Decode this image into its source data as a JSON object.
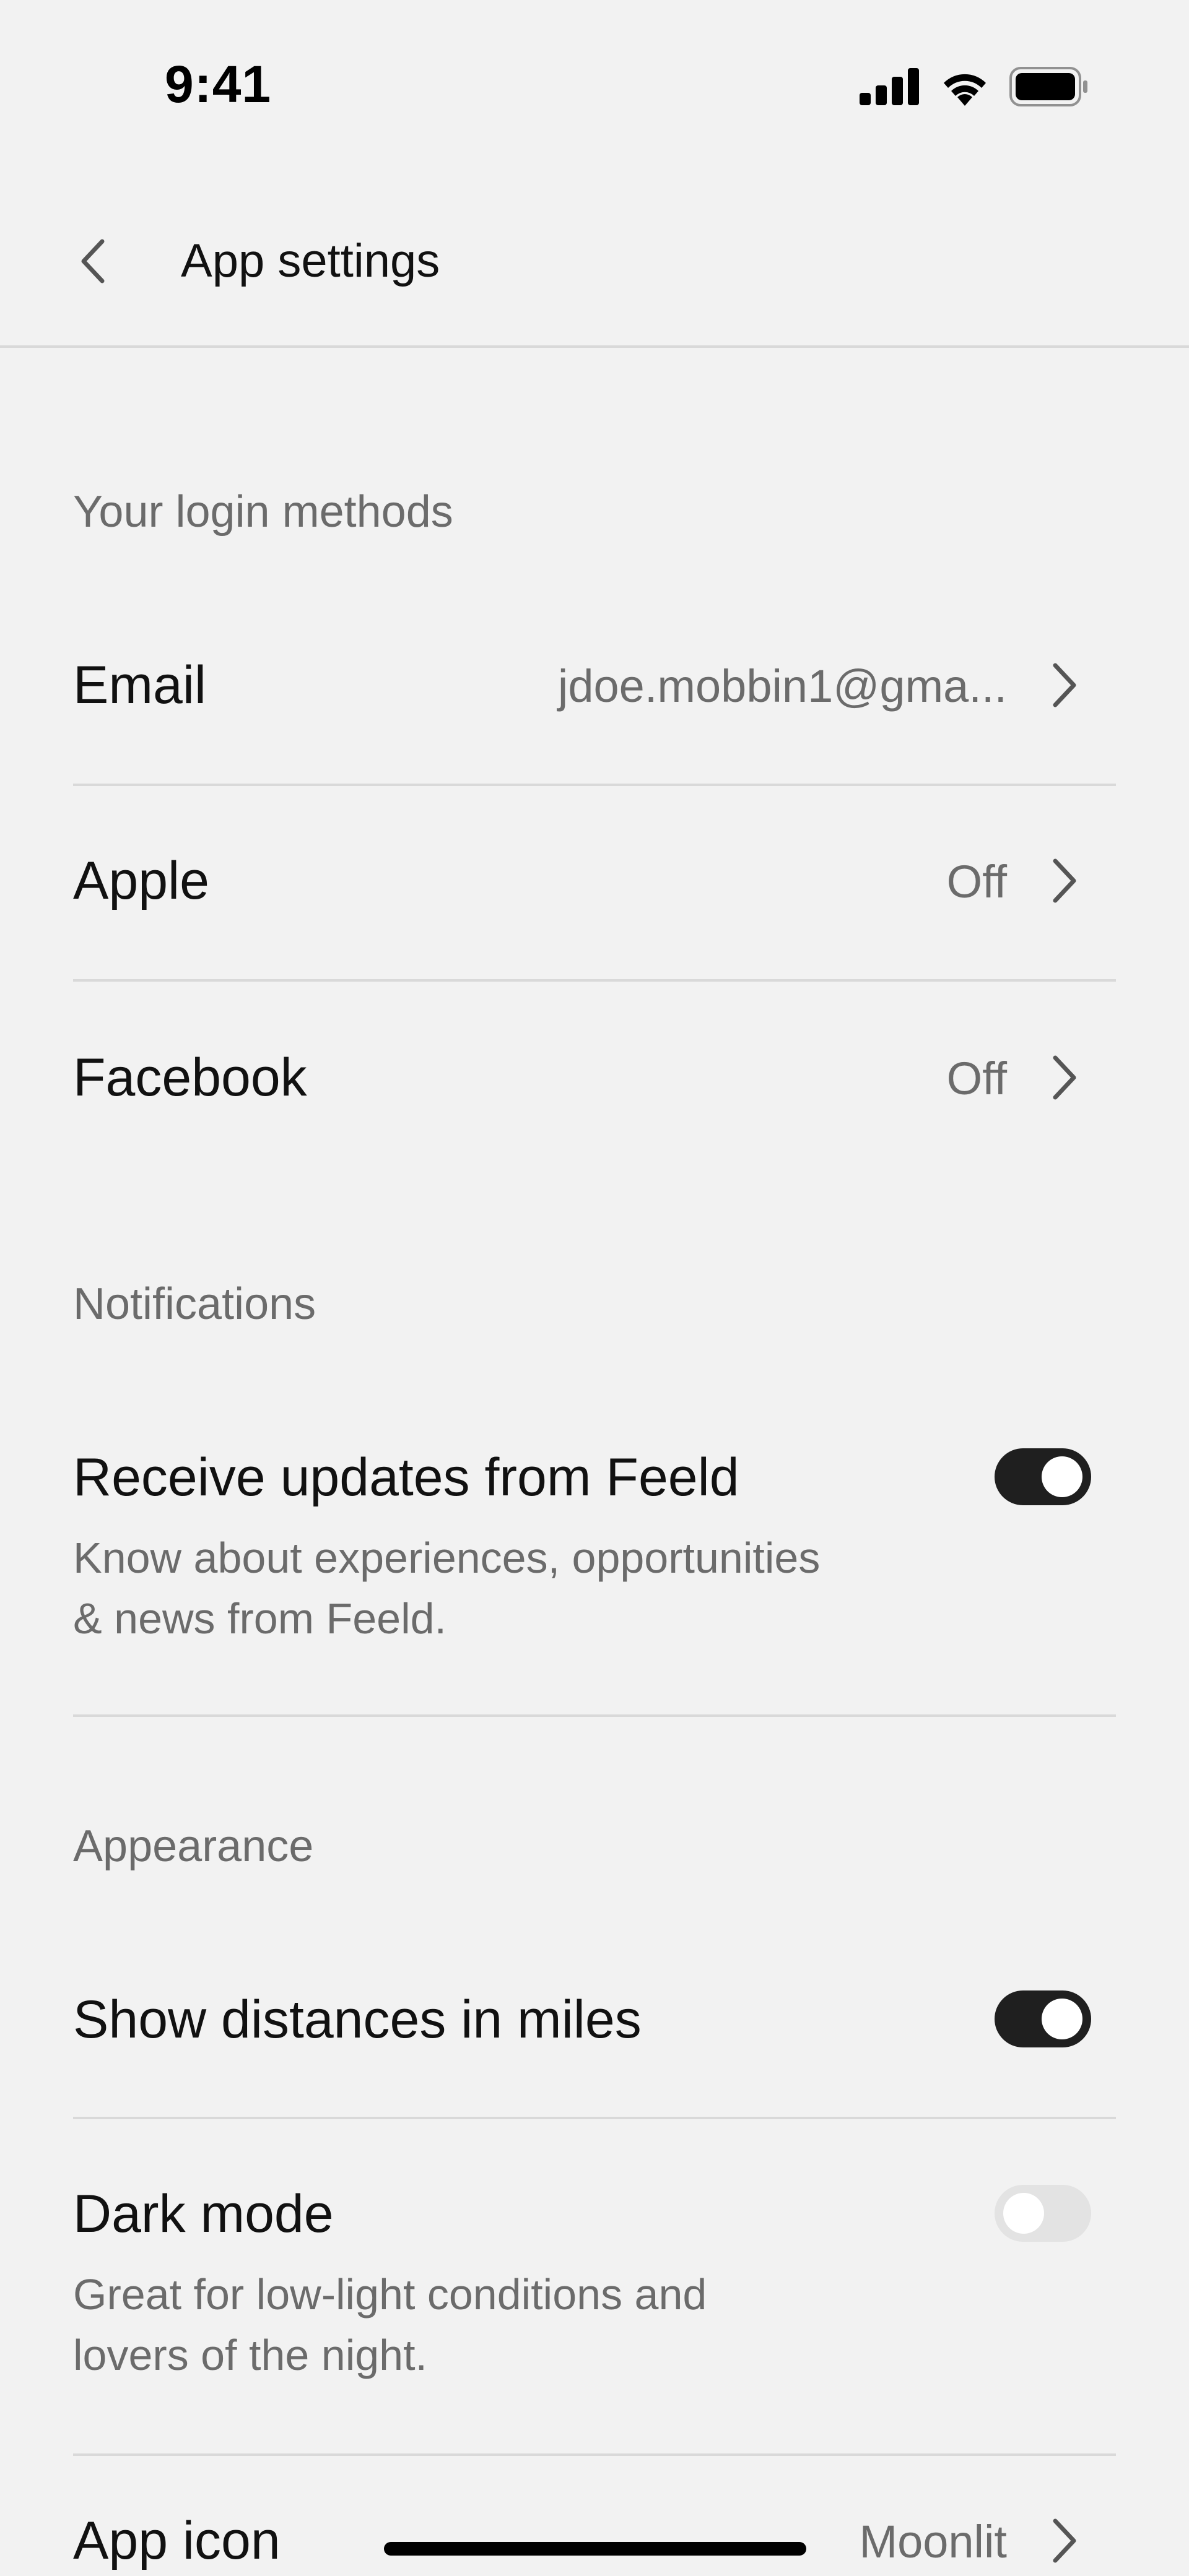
{
  "status_bar": {
    "time": "9:41"
  },
  "nav": {
    "title": "App settings"
  },
  "sections": {
    "login": {
      "header": "Your login methods",
      "rows": [
        {
          "label": "Email",
          "value": "jdoe.mobbin1@gma..."
        },
        {
          "label": "Apple",
          "value": "Off"
        },
        {
          "label": "Facebook",
          "value": "Off"
        }
      ]
    },
    "notifications": {
      "header": "Notifications",
      "updates": {
        "label": "Receive updates from Feeld",
        "desc_line1": "Know about experiences, opportunities",
        "desc_line2": "& news from Feeld.",
        "enabled": true
      }
    },
    "appearance": {
      "header": "Appearance",
      "miles": {
        "label": "Show distances in miles",
        "enabled": true
      },
      "dark_mode": {
        "label": "Dark mode",
        "desc_line1": "Great for low-light conditions and",
        "desc_line2": "lovers of the night.",
        "enabled": false
      },
      "app_icon": {
        "label": "App icon",
        "value": "Moonlit"
      }
    }
  },
  "colors": {
    "background": "#f2f2f2",
    "toggle_on": "#1f1f1f",
    "toggle_off": "#e3e3e3",
    "secondary_text": "#6b6b6b",
    "divider": "#d9d9d9"
  },
  "icons": {
    "back": "chevron-left-icon",
    "row_chevron": "chevron-right-icon",
    "signal": "signal-icon",
    "wifi": "wifi-icon",
    "battery": "battery-icon"
  }
}
